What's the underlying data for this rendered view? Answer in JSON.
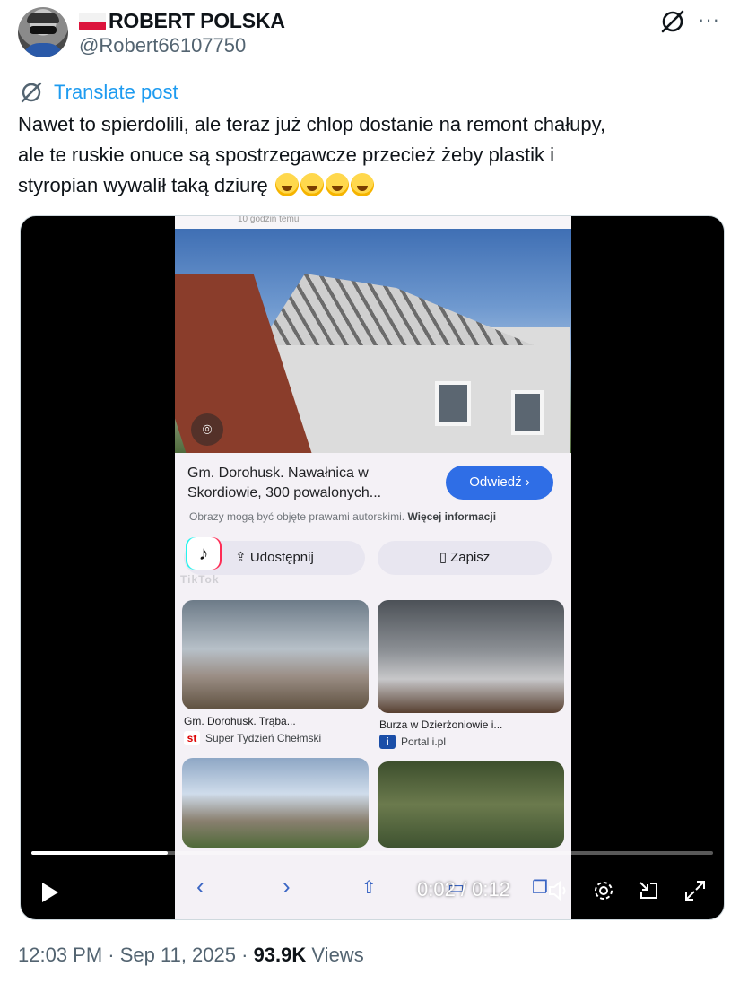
{
  "author": {
    "display_name": "ROBERT POLSKA",
    "handle": "@Robert66107750",
    "flag": "poland-flag"
  },
  "post": {
    "translate_label": "Translate post",
    "text_lines": [
      "Nawet to spierdolili, ale teraz już chlop dostanie na remont chałupy,",
      "ale te ruskie onuce są spostrzegawcze przecież żeby plastik i",
      "styropian wywalił taką dziurę"
    ],
    "emoji_count": 4,
    "emoji_name": "rolling-on-floor-laughing"
  },
  "video": {
    "screen": {
      "top_text": "10 godzin temu",
      "result_title": "Gm. Dorohusk. Nawałnica w Skordiowie, 300 powalonych...",
      "visit_label": "Odwiedź ›",
      "rights_text": "Obrazy mogą być objęte prawami autorskimi.",
      "rights_link": "Więcej informacji",
      "share_label": "Udostępnij",
      "save_label": "Zapisz",
      "tiktok_label": "TikTok",
      "results": [
        {
          "caption": "Gm. Dorohusk. Trąba...",
          "source": "Super Tydzień Chełmski",
          "badge": "st"
        },
        {
          "caption": "Burza w Dzierżoniowie i...",
          "source": "Portal i.pl",
          "badge": "i"
        }
      ]
    },
    "time_display": "0:02 / 0:12",
    "progress_fraction": 0.2
  },
  "meta": {
    "time": "12:03 PM",
    "date": "Sep 11, 2025",
    "views_count": "93.9K",
    "views_label": "Views"
  },
  "colors": {
    "accent": "#1d9bf0",
    "text": "#0f1419",
    "muted": "#536471"
  }
}
